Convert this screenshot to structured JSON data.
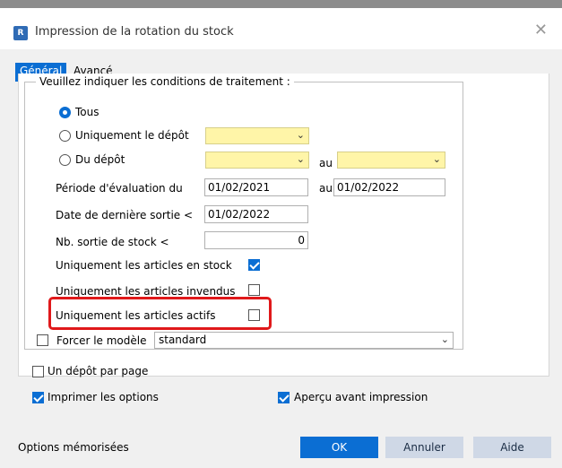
{
  "window": {
    "title": "Impression de la rotation du stock",
    "close_glyph": "✕",
    "app_icon_text": "R"
  },
  "tabs": [
    {
      "label": "Général",
      "active": true
    },
    {
      "label": "Avancé",
      "active": false
    }
  ],
  "group": {
    "legend": "Veuillez indiquer les conditions de traitement :"
  },
  "radios": {
    "tous": {
      "label": "Tous",
      "selected": true
    },
    "uniquement_depot": {
      "label": "Uniquement le dépôt",
      "selected": false
    },
    "du_depot": {
      "label": "Du dépôt",
      "selected": false
    }
  },
  "depot_range": {
    "to_label": "au"
  },
  "periode": {
    "label": "Période d'évaluation du",
    "from": "01/02/2021",
    "to_label": "au",
    "to": "01/02/2022"
  },
  "derniere_sortie": {
    "label": "Date de dernière sortie <",
    "value": "01/02/2022"
  },
  "nb_sortie": {
    "label": "Nb. sortie de stock <",
    "value": "0"
  },
  "options": {
    "en_stock": {
      "label": "Uniquement les articles en stock",
      "checked": true
    },
    "invendus": {
      "label": "Uniquement les articles invendus",
      "checked": false
    },
    "actifs": {
      "label": "Uniquement les articles actifs",
      "checked": false
    }
  },
  "modele": {
    "label": "Forcer le modèle",
    "checked": false,
    "value": "standard"
  },
  "depot_par_page": {
    "label": "Un dépôt par page",
    "checked": false
  },
  "imprimer_options": {
    "label": "Imprimer les options",
    "checked": true
  },
  "apercu": {
    "label": "Aperçu avant impression",
    "checked": true
  },
  "footer": {
    "options_memorisees": "Options mémorisées",
    "ok": "OK",
    "annuler": "Annuler",
    "aide": "Aide"
  },
  "icons": {
    "chevron": "chevron-down-icon"
  },
  "colors": {
    "accent": "#0b6ed3",
    "combo_yellow": "#fff5a8",
    "highlight": "#e0191b"
  }
}
